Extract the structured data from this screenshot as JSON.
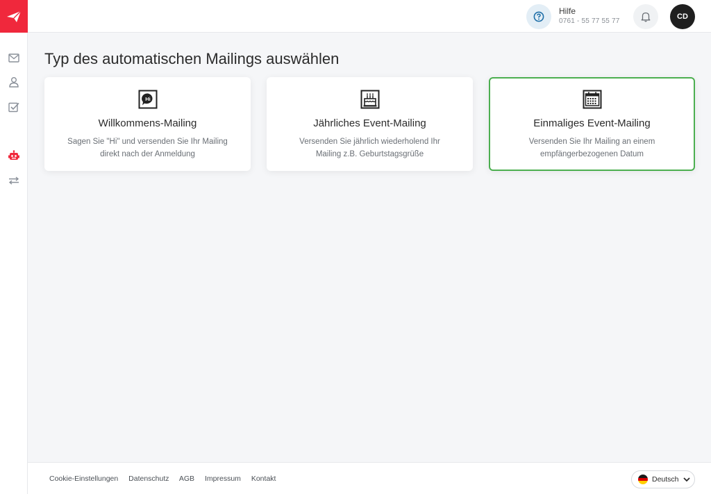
{
  "page": {
    "title": "Typ des automatischen Mailings auswählen"
  },
  "header": {
    "help_title": "Hilfe",
    "help_phone": "0761 - 55 77 55 77",
    "avatar_initials": "CD"
  },
  "sidebar": {
    "items": [
      {
        "icon": "mail-icon"
      },
      {
        "icon": "user-icon"
      },
      {
        "icon": "checkbox-icon"
      },
      {
        "icon": "robot-icon",
        "active": true
      },
      {
        "icon": "transfer-icon"
      }
    ]
  },
  "cards": [
    {
      "icon": "hi-speech-bubble-icon",
      "title": "Willkommens-Mailing",
      "desc_line1": "Sagen Sie \"Hi\" und versenden Sie Ihr Mailing",
      "desc_line2": "direkt nach der Anmeldung",
      "selected": false
    },
    {
      "icon": "birthday-cake-icon",
      "title": "Jährliches Event-Mailing",
      "desc_line1": "Versenden Sie jährlich wiederholend Ihr",
      "desc_line2": "Mailing z.B. Geburtstagsgrüße",
      "selected": false
    },
    {
      "icon": "calendar-icon",
      "title": "Einmaliges Event-Mailing",
      "desc_line1": "Versenden Sie Ihr Mailing an einem",
      "desc_line2": "empfängerbezogenen Datum",
      "selected": true
    }
  ],
  "footer": {
    "links": [
      "Cookie-Einstellungen",
      "Datenschutz",
      "AGB",
      "Impressum",
      "Kontakt"
    ],
    "language": "Deutsch"
  },
  "colors": {
    "brand_red": "#f0283c",
    "selected_border": "#4caf50",
    "active_nav": "#f0283c"
  }
}
